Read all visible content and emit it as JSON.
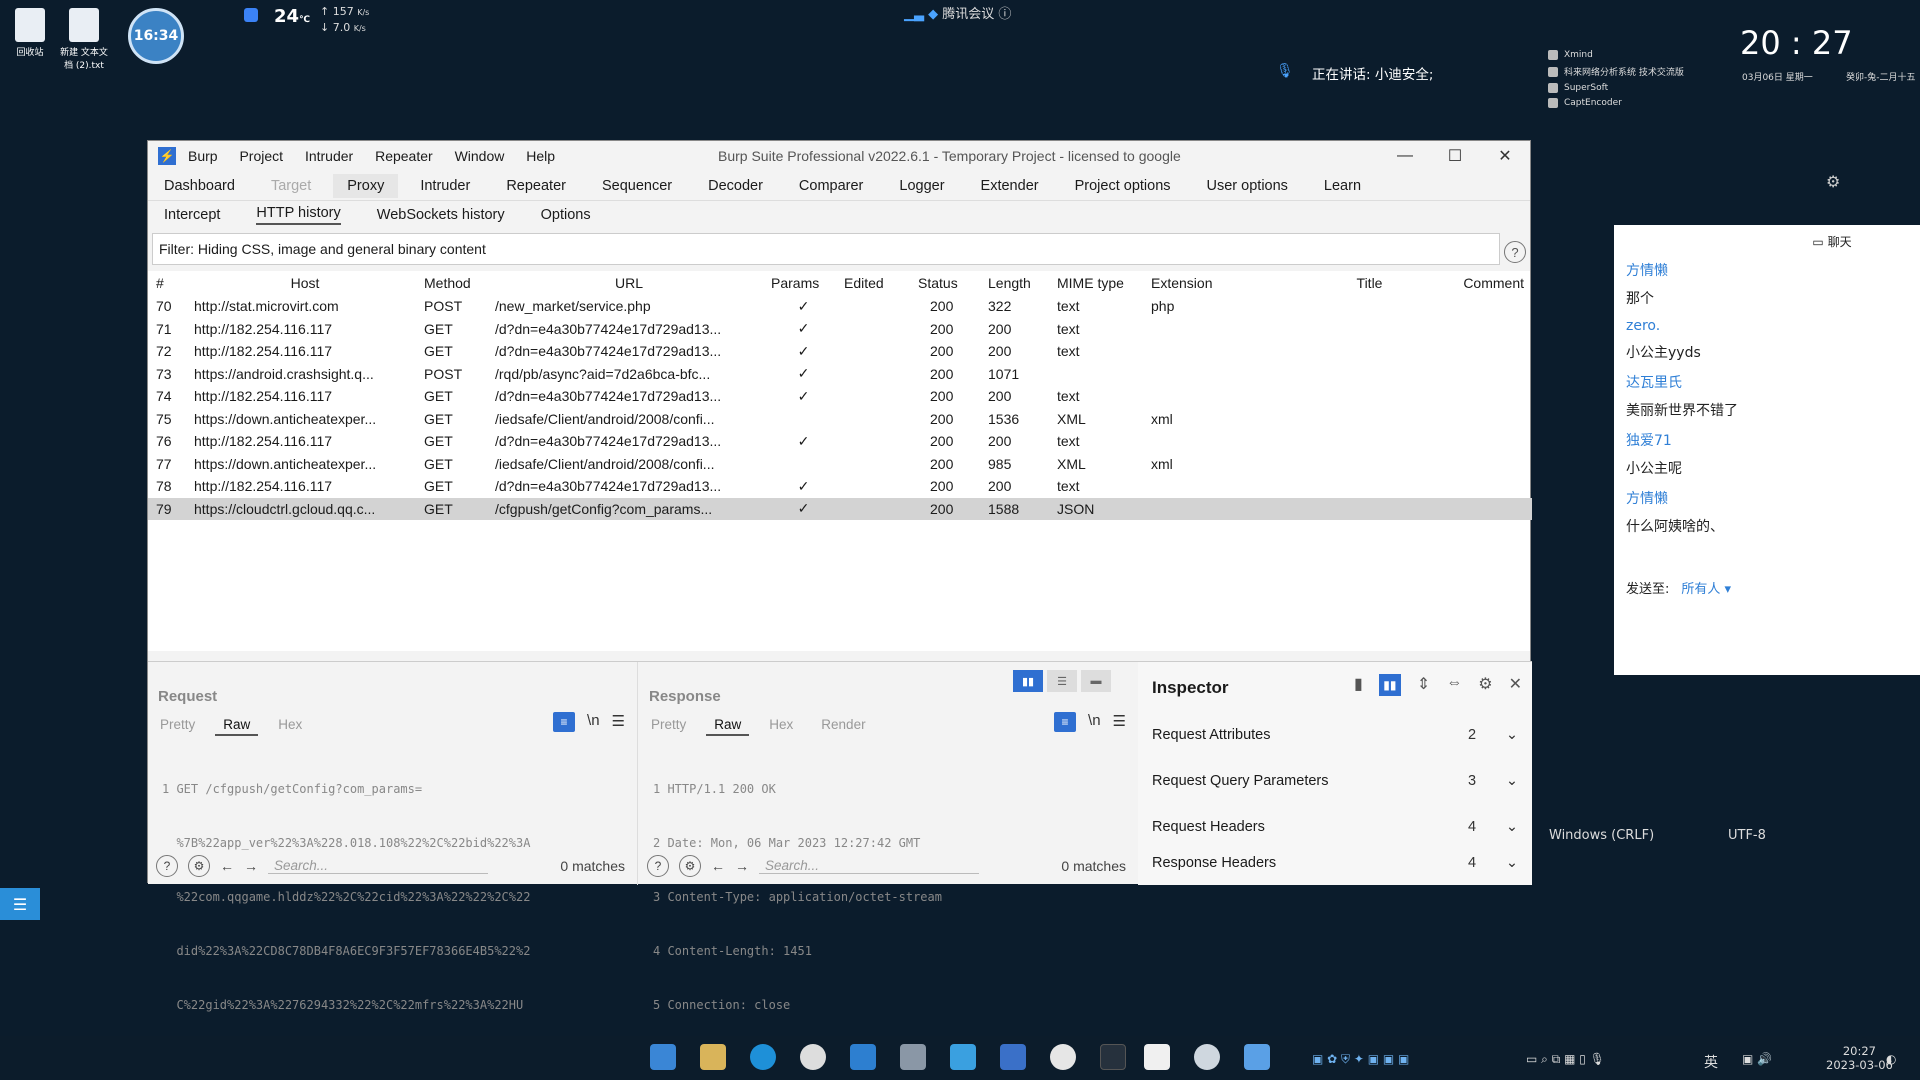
{
  "desktop": {
    "icons": [
      {
        "label": "回收站"
      },
      {
        "label": "新建 文本文档 (2).txt"
      }
    ],
    "clock_badge": "16:34",
    "temp": "24",
    "temp_unit": "℃",
    "net_up": "157",
    "net_up_unit": "K/s",
    "net_down": "7.0",
    "net_down_unit": "K/s",
    "meeting_app": "腾讯会议",
    "speaking": "正在讲话: 小迪安全;",
    "right_apps": [
      "Xmind",
      "科来网络分析系统 技术交流版",
      "SuperSoft",
      "CaptEncoder"
    ],
    "big_clock": "20 : 27",
    "big_date": "03月06日",
    "big_weekday": "星期一",
    "lunar": "癸卯-兔-二月十五",
    "encoding_eol": "Windows (CRLF)",
    "encoding": "UTF-8"
  },
  "burp": {
    "menu": [
      "Burp",
      "Project",
      "Intruder",
      "Repeater",
      "Window",
      "Help"
    ],
    "title": "Burp Suite Professional v2022.6.1 - Temporary Project - licensed to google",
    "main_tabs": [
      "Dashboard",
      "Target",
      "Proxy",
      "Intruder",
      "Repeater",
      "Sequencer",
      "Decoder",
      "Comparer",
      "Logger",
      "Extender",
      "Project options",
      "User options",
      "Learn"
    ],
    "sub_tabs": [
      "Intercept",
      "HTTP history",
      "WebSockets history",
      "Options"
    ],
    "filter": "Filter: Hiding CSS, image and general binary content",
    "columns": [
      "#",
      "Host",
      "Method",
      "URL",
      "Params",
      "Edited",
      "Status",
      "Length",
      "MIME type",
      "Extension",
      "Title",
      "Comment"
    ],
    "rows": [
      [
        "70",
        "http://stat.microvirt.com",
        "POST",
        "/new_market/service.php",
        "✓",
        "",
        "200",
        "322",
        "text",
        "php",
        "",
        ""
      ],
      [
        "71",
        "http://182.254.116.117",
        "GET",
        "/d?dn=e4a30b77424e17d729ad13...",
        "✓",
        "",
        "200",
        "200",
        "text",
        "",
        "",
        ""
      ],
      [
        "72",
        "http://182.254.116.117",
        "GET",
        "/d?dn=e4a30b77424e17d729ad13...",
        "✓",
        "",
        "200",
        "200",
        "text",
        "",
        "",
        ""
      ],
      [
        "73",
        "https://android.crashsight.q...",
        "POST",
        "/rqd/pb/async?aid=7d2a6bca-bfc...",
        "✓",
        "",
        "200",
        "1071",
        "",
        "",
        "",
        ""
      ],
      [
        "74",
        "http://182.254.116.117",
        "GET",
        "/d?dn=e4a30b77424e17d729ad13...",
        "✓",
        "",
        "200",
        "200",
        "text",
        "",
        "",
        ""
      ],
      [
        "75",
        "https://down.anticheatexper...",
        "GET",
        "/iedsafe/Client/android/2008/confi...",
        "",
        "",
        "200",
        "1536",
        "XML",
        "xml",
        "",
        ""
      ],
      [
        "76",
        "http://182.254.116.117",
        "GET",
        "/d?dn=e4a30b77424e17d729ad13...",
        "✓",
        "",
        "200",
        "200",
        "text",
        "",
        "",
        ""
      ],
      [
        "77",
        "https://down.anticheatexper...",
        "GET",
        "/iedsafe/Client/android/2008/confi...",
        "",
        "",
        "200",
        "985",
        "XML",
        "xml",
        "",
        ""
      ],
      [
        "78",
        "http://182.254.116.117",
        "GET",
        "/d?dn=e4a30b77424e17d729ad13...",
        "✓",
        "",
        "200",
        "200",
        "text",
        "",
        "",
        ""
      ],
      [
        "79",
        "https://cloudctrl.gcloud.qq.c...",
        "GET",
        "/cfgpush/getConfig?com_params...",
        "✓",
        "",
        "200",
        "1588",
        "JSON",
        "",
        "",
        ""
      ]
    ],
    "selected_row": 9,
    "request": {
      "title": "Request",
      "tabs": [
        "Pretty",
        "Raw",
        "Hex"
      ],
      "lines": [
        "1 GET /cfgpush/getConfig?com_params=",
        "  %7B%22app_ver%22%3A%228.018.108%22%2C%22bid%22%3A",
        "  %22com.qqgame.hlddz%22%2C%22cid%22%3A%22%22%2C%22",
        "  did%22%3A%22CD8C78DB4F8A6EC9F3F57EF78366E4B5%22%2",
        "  C%22gid%22%3A%2276294332%22%2C%22mfrs%22%3A%22HU"
      ],
      "search_placeholder": "Search...",
      "matches": "0 matches"
    },
    "response": {
      "title": "Response",
      "tabs": [
        "Pretty",
        "Raw",
        "Hex",
        "Render"
      ],
      "lines": [
        "1 HTTP/1.1 200 OK",
        "2 Date: Mon, 06 Mar 2023 12:27:42 GMT",
        "3 Content-Type: application/octet-stream",
        "4 Content-Length: 1451",
        "5 Connection: close"
      ],
      "search_placeholder": "Search...",
      "matches": "0 matches"
    },
    "inspector": {
      "title": "Inspector",
      "rows": [
        {
          "label": "Request Attributes",
          "count": "2"
        },
        {
          "label": "Request Query Parameters",
          "count": "3"
        },
        {
          "label": "Request Headers",
          "count": "4"
        },
        {
          "label": "Response Headers",
          "count": "4"
        }
      ]
    }
  },
  "chat": {
    "header": "聊天",
    "messages": [
      {
        "name": "方情懒",
        "text": "那个"
      },
      {
        "name": "zero.",
        "text": "小公主yyds"
      },
      {
        "name": "达瓦里氏",
        "text": "美丽新世界不错了"
      },
      {
        "name": "独爱71",
        "text": "小公主呢"
      },
      {
        "name": "方情懒",
        "text": "什么阿姨啥的、"
      }
    ],
    "send_to_label": "发送至:",
    "send_to_value": "所有人 ▾"
  },
  "taskbar": {
    "ime": "英",
    "time": "20:27",
    "date": "2023-03-06"
  },
  "colors": {
    "accent": "#2f6fd1",
    "desktop_bg": "#0b1c2c",
    "chat_name": "#2f7fd6"
  }
}
